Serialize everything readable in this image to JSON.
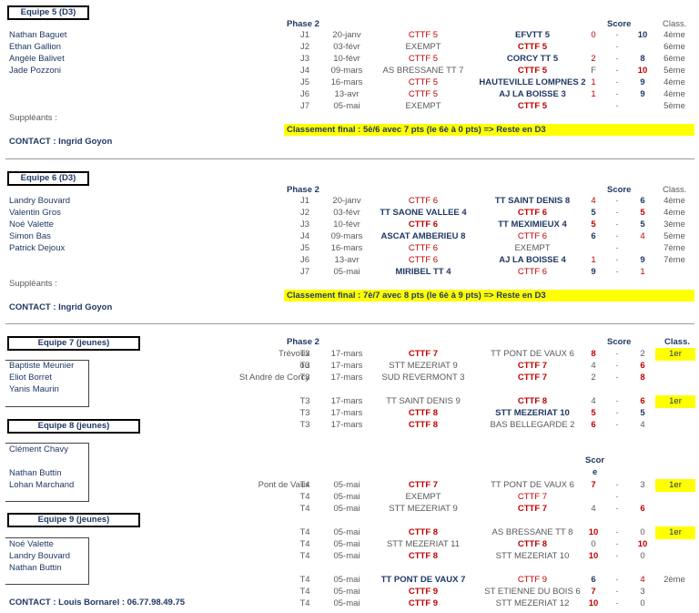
{
  "sections": [
    {
      "team": "Equipe 5 (D3)",
      "players": [
        "Nathan Baguet",
        "Ethan Gallion",
        "Angèle Balivet",
        "Jade Pozzoni"
      ],
      "subs_label": "Suppléants :",
      "contact": "CONTACT : Ingrid Goyon",
      "phase": "Phase 2",
      "score_header": "Score",
      "class_header": "Class.",
      "matches": [
        {
          "j": "J1",
          "date": "20-janv",
          "home": "CTTF 5",
          "home_style": "red",
          "away": "EFVTT 5",
          "away_style": "bold-blue",
          "s1": "0",
          "s1_style": "red",
          "dash": "-",
          "s2": "10",
          "s2_style": "bold-blue",
          "cls": "4ème"
        },
        {
          "j": "J2",
          "date": "03-févr",
          "home": "EXEMPT",
          "home_style": "gray",
          "away": "CTTF 5",
          "away_style": "bold-red",
          "s1": "",
          "s1_style": "",
          "dash": "-",
          "s2": "",
          "s2_style": "",
          "cls": "6ème"
        },
        {
          "j": "J3",
          "date": "10-févr",
          "home": "CTTF 5",
          "home_style": "red",
          "away": "CORCY TT 5",
          "away_style": "bold-blue",
          "s1": "2",
          "s1_style": "red",
          "dash": "-",
          "s2": "8",
          "s2_style": "bold-blue",
          "cls": "6ème"
        },
        {
          "j": "J4",
          "date": "09-mars",
          "home": "AS BRESSANE TT 7",
          "home_style": "gray",
          "away": "CTTF 5",
          "away_style": "bold-red",
          "s1": "F",
          "s1_style": "gray",
          "dash": "-",
          "s2": "10",
          "s2_style": "bold-red",
          "cls": "5ème"
        },
        {
          "j": "J5",
          "date": "16-mars",
          "home": "CTTF 5",
          "home_style": "red",
          "away": "HAUTEVILLE LOMPNES 2",
          "away_style": "bold-blue",
          "s1": "1",
          "s1_style": "red",
          "dash": "-",
          "s2": "9",
          "s2_style": "bold-blue",
          "cls": "4ème"
        },
        {
          "j": "J6",
          "date": "13-avr",
          "home": "CTTF 5",
          "home_style": "red",
          "away": "AJ LA BOISSE 3",
          "away_style": "bold-blue",
          "s1": "1",
          "s1_style": "red",
          "dash": "-",
          "s2": "9",
          "s2_style": "bold-blue",
          "cls": "4ème"
        },
        {
          "j": "J7",
          "date": "05-mai",
          "home": "EXEMPT",
          "home_style": "gray",
          "away": "CTTF 5",
          "away_style": "bold-red",
          "s1": "",
          "s1_style": "",
          "dash": "-",
          "s2": "",
          "s2_style": "",
          "cls": "5ème"
        }
      ],
      "final": "Classement final :  5è/6 avec 7 pts (le 6è à 0 pts) => Reste en D3"
    },
    {
      "team": "Equipe 6 (D3)",
      "players": [
        "Landry Bouvard",
        "Valentin Gros",
        "Noé Valette",
        "Simon Bas",
        "Patrick Dejoux"
      ],
      "subs_label": "Suppléants :",
      "contact": "CONTACT : Ingrid Goyon",
      "phase": "Phase 2",
      "score_header": "Score",
      "class_header": "Class.",
      "matches": [
        {
          "j": "J1",
          "date": "20-janv",
          "home": "CTTF 6",
          "home_style": "red",
          "away": "TT SAINT DENIS 8",
          "away_style": "bold-blue",
          "s1": "4",
          "s1_style": "red",
          "dash": "-",
          "s2": "6",
          "s2_style": "bold-blue",
          "cls": "4ème"
        },
        {
          "j": "J2",
          "date": "03-févr",
          "home": "TT SAONE VALLEE 4",
          "home_style": "bold-blue",
          "away": "CTTF 6",
          "away_style": "bold-red",
          "s1": "5",
          "s1_style": "bold-blue",
          "dash": "-",
          "s2": "5",
          "s2_style": "bold-red",
          "cls": "4ème"
        },
        {
          "j": "J3",
          "date": "10-févr",
          "home": "CTTF 6",
          "home_style": "bold-red",
          "away": "TT MEXIMIEUX 4",
          "away_style": "bold-blue",
          "s1": "5",
          "s1_style": "bold-red",
          "dash": "-",
          "s2": "5",
          "s2_style": "bold-blue",
          "cls": "3ème"
        },
        {
          "j": "J4",
          "date": "09-mars",
          "home": "ASCAT AMBERIEU 8",
          "home_style": "bold-blue",
          "away": "CTTF 6",
          "away_style": "red",
          "s1": "6",
          "s1_style": "bold-blue",
          "dash": "-",
          "s2": "4",
          "s2_style": "red",
          "cls": "5ème"
        },
        {
          "j": "J5",
          "date": "16-mars",
          "home": "CTTF 6",
          "home_style": "red",
          "away": "EXEMPT",
          "away_style": "gray",
          "s1": "",
          "s1_style": "",
          "dash": "-",
          "s2": "",
          "s2_style": "",
          "cls": "7ème"
        },
        {
          "j": "J6",
          "date": "13-avr",
          "home": "CTTF 6",
          "home_style": "red",
          "away": "AJ LA BOISSE 4",
          "away_style": "bold-blue",
          "s1": "1",
          "s1_style": "red",
          "dash": "-",
          "s2": "9",
          "s2_style": "bold-blue",
          "cls": "7ème"
        },
        {
          "j": "J7",
          "date": "05-mai",
          "home": "MIRIBEL TT 4",
          "home_style": "bold-blue",
          "away": "CTTF 6",
          "away_style": "red",
          "s1": "9",
          "s1_style": "bold-blue",
          "dash": "-",
          "s2": "1",
          "s2_style": "red",
          "cls": ""
        }
      ],
      "final": "Classement final :  7è/7 avec 8 pts (le 6è à 9 pts) => Reste en D3"
    }
  ],
  "youth": {
    "phase": "Phase 2",
    "score_header": "Score",
    "score_header_split": [
      "Scor",
      "e"
    ],
    "class_header": "Class.",
    "teams": [
      {
        "team": "Equipe 7 (jeunes)",
        "players": [
          "Baptiste Meunier",
          "Eliot Borret",
          "Yanis Maurin"
        ]
      },
      {
        "team": "Equipe 8 (jeunes)",
        "players": [
          "Clément Chavy",
          "",
          "Nathan Buttin",
          "Lohan Marchand"
        ]
      },
      {
        "team": "Equipe 9 (jeunes)",
        "players": [
          "Noé Valette",
          "Landry Bouvard",
          "Nathan Buttin"
        ]
      }
    ],
    "contact": "CONTACT : Louis Bornarel : 06.77.98.49.75",
    "t3_rows": [
      {
        "loc": "Trévoux",
        "j": "T3",
        "date": "17-mars",
        "home": "CTTF 7",
        "home_style": "bold-red",
        "away": "TT PONT DE VAUX 6",
        "away_style": "gray",
        "s1": "8",
        "s1_style": "bold-red",
        "dash": "-",
        "s2": "2",
        "s2_style": "gray",
        "cls": "1er",
        "hl": true
      },
      {
        "loc": "ou",
        "j": "T3",
        "date": "17-mars",
        "home": "STT MEZERIAT 9",
        "home_style": "gray",
        "away": "CTTF 7",
        "away_style": "bold-red",
        "s1": "4",
        "s1_style": "gray",
        "dash": "-",
        "s2": "6",
        "s2_style": "bold-red",
        "cls": "",
        "hl": false
      },
      {
        "loc": "St André de Corcy",
        "j": "T3",
        "date": "17-mars",
        "home": "SUD REVERMONT 3",
        "home_style": "gray",
        "away": "CTTF 7",
        "away_style": "bold-red",
        "s1": "2",
        "s1_style": "gray",
        "dash": "-",
        "s2": "8",
        "s2_style": "bold-red",
        "cls": "",
        "hl": false
      },
      {
        "loc": "",
        "j": "T3",
        "date": "17-mars",
        "home": "TT SAINT DENIS 9",
        "home_style": "gray",
        "away": "CTTF 8",
        "away_style": "bold-red",
        "s1": "4",
        "s1_style": "gray",
        "dash": "-",
        "s2": "6",
        "s2_style": "bold-red",
        "cls": "1er",
        "hl": true
      },
      {
        "loc": "",
        "j": "T3",
        "date": "17-mars",
        "home": "CTTF 8",
        "home_style": "bold-red",
        "away": "STT MEZERIAT 10",
        "away_style": "bold-blue",
        "s1": "5",
        "s1_style": "bold-red",
        "dash": "-",
        "s2": "5",
        "s2_style": "bold-blue",
        "cls": "",
        "hl": false
      },
      {
        "loc": "",
        "j": "T3",
        "date": "17-mars",
        "home": "CTTF 8",
        "home_style": "bold-red",
        "away": "BAS BELLEGARDE 2",
        "away_style": "gray",
        "s1": "6",
        "s1_style": "bold-red",
        "dash": "-",
        "s2": "4",
        "s2_style": "gray",
        "cls": "",
        "hl": false
      }
    ],
    "t4_rows": [
      {
        "loc": "Pont de Vaux",
        "j": "T4",
        "date": "05-mai",
        "home": "CTTF 7",
        "home_style": "bold-red",
        "away": "TT PONT DE VAUX 6",
        "away_style": "gray",
        "s1": "7",
        "s1_style": "bold-red",
        "dash": "-",
        "s2": "3",
        "s2_style": "gray",
        "cls": "1er",
        "hl": true
      },
      {
        "loc": "",
        "j": "T4",
        "date": "05-mai",
        "home": "EXEMPT",
        "home_style": "gray",
        "away": "CTTF 7",
        "away_style": "red",
        "s1": "",
        "s1_style": "",
        "dash": "-",
        "s2": "",
        "s2_style": "",
        "cls": "",
        "hl": false
      },
      {
        "loc": "",
        "j": "T4",
        "date": "05-mai",
        "home": "STT MEZERIAT 9",
        "home_style": "gray",
        "away": "CTTF 7",
        "away_style": "bold-red",
        "s1": "4",
        "s1_style": "gray",
        "dash": "-",
        "s2": "6",
        "s2_style": "bold-red",
        "cls": "",
        "hl": false
      },
      {
        "loc": "",
        "j": "T4",
        "date": "05-mai",
        "home": "CTTF 8",
        "home_style": "bold-red",
        "away": "AS BRESSANE TT 8",
        "away_style": "gray",
        "s1": "10",
        "s1_style": "bold-red",
        "dash": "-",
        "s2": "0",
        "s2_style": "gray",
        "cls": "1er",
        "hl": true
      },
      {
        "loc": "",
        "j": "T4",
        "date": "05-mai",
        "home": "STT MEZERIAT 11",
        "home_style": "gray",
        "away": "CTTF 8",
        "away_style": "bold-red",
        "s1": "0",
        "s1_style": "gray",
        "dash": "-",
        "s2": "10",
        "s2_style": "bold-red",
        "cls": "",
        "hl": false
      },
      {
        "loc": "",
        "j": "T4",
        "date": "05-mai",
        "home": "CTTF 8",
        "home_style": "bold-red",
        "away": "STT MEZERIAT 10",
        "away_style": "gray",
        "s1": "10",
        "s1_style": "bold-red",
        "dash": "-",
        "s2": "0",
        "s2_style": "gray",
        "cls": "",
        "hl": false
      },
      {
        "loc": "",
        "j": "T4",
        "date": "05-mai",
        "home": "TT PONT DE VAUX 7",
        "home_style": "bold-blue",
        "away": "CTTF 9",
        "away_style": "red",
        "s1": "6",
        "s1_style": "bold-blue",
        "dash": "-",
        "s2": "4",
        "s2_style": "red",
        "cls": "2ème",
        "hl": false
      },
      {
        "loc": "",
        "j": "T4",
        "date": "05-mai",
        "home": "CTTF 9",
        "home_style": "bold-red",
        "away": "ST ETIENNE DU BOIS 6",
        "away_style": "gray",
        "s1": "7",
        "s1_style": "bold-red",
        "dash": "-",
        "s2": "3",
        "s2_style": "gray",
        "cls": "",
        "hl": false
      },
      {
        "loc": "",
        "j": "T4",
        "date": "05-mai",
        "home": "CTTF 9",
        "home_style": "bold-red",
        "away": "STT MEZERIAT 12",
        "away_style": "gray",
        "s1": "10",
        "s1_style": "bold-red",
        "dash": "-",
        "s2": "0",
        "s2_style": "gray",
        "cls": "",
        "hl": false
      }
    ]
  },
  "colors": {
    "red": "#c00000",
    "blue": "#1f3864",
    "gray": "#595959",
    "highlight": "#ffff00"
  }
}
